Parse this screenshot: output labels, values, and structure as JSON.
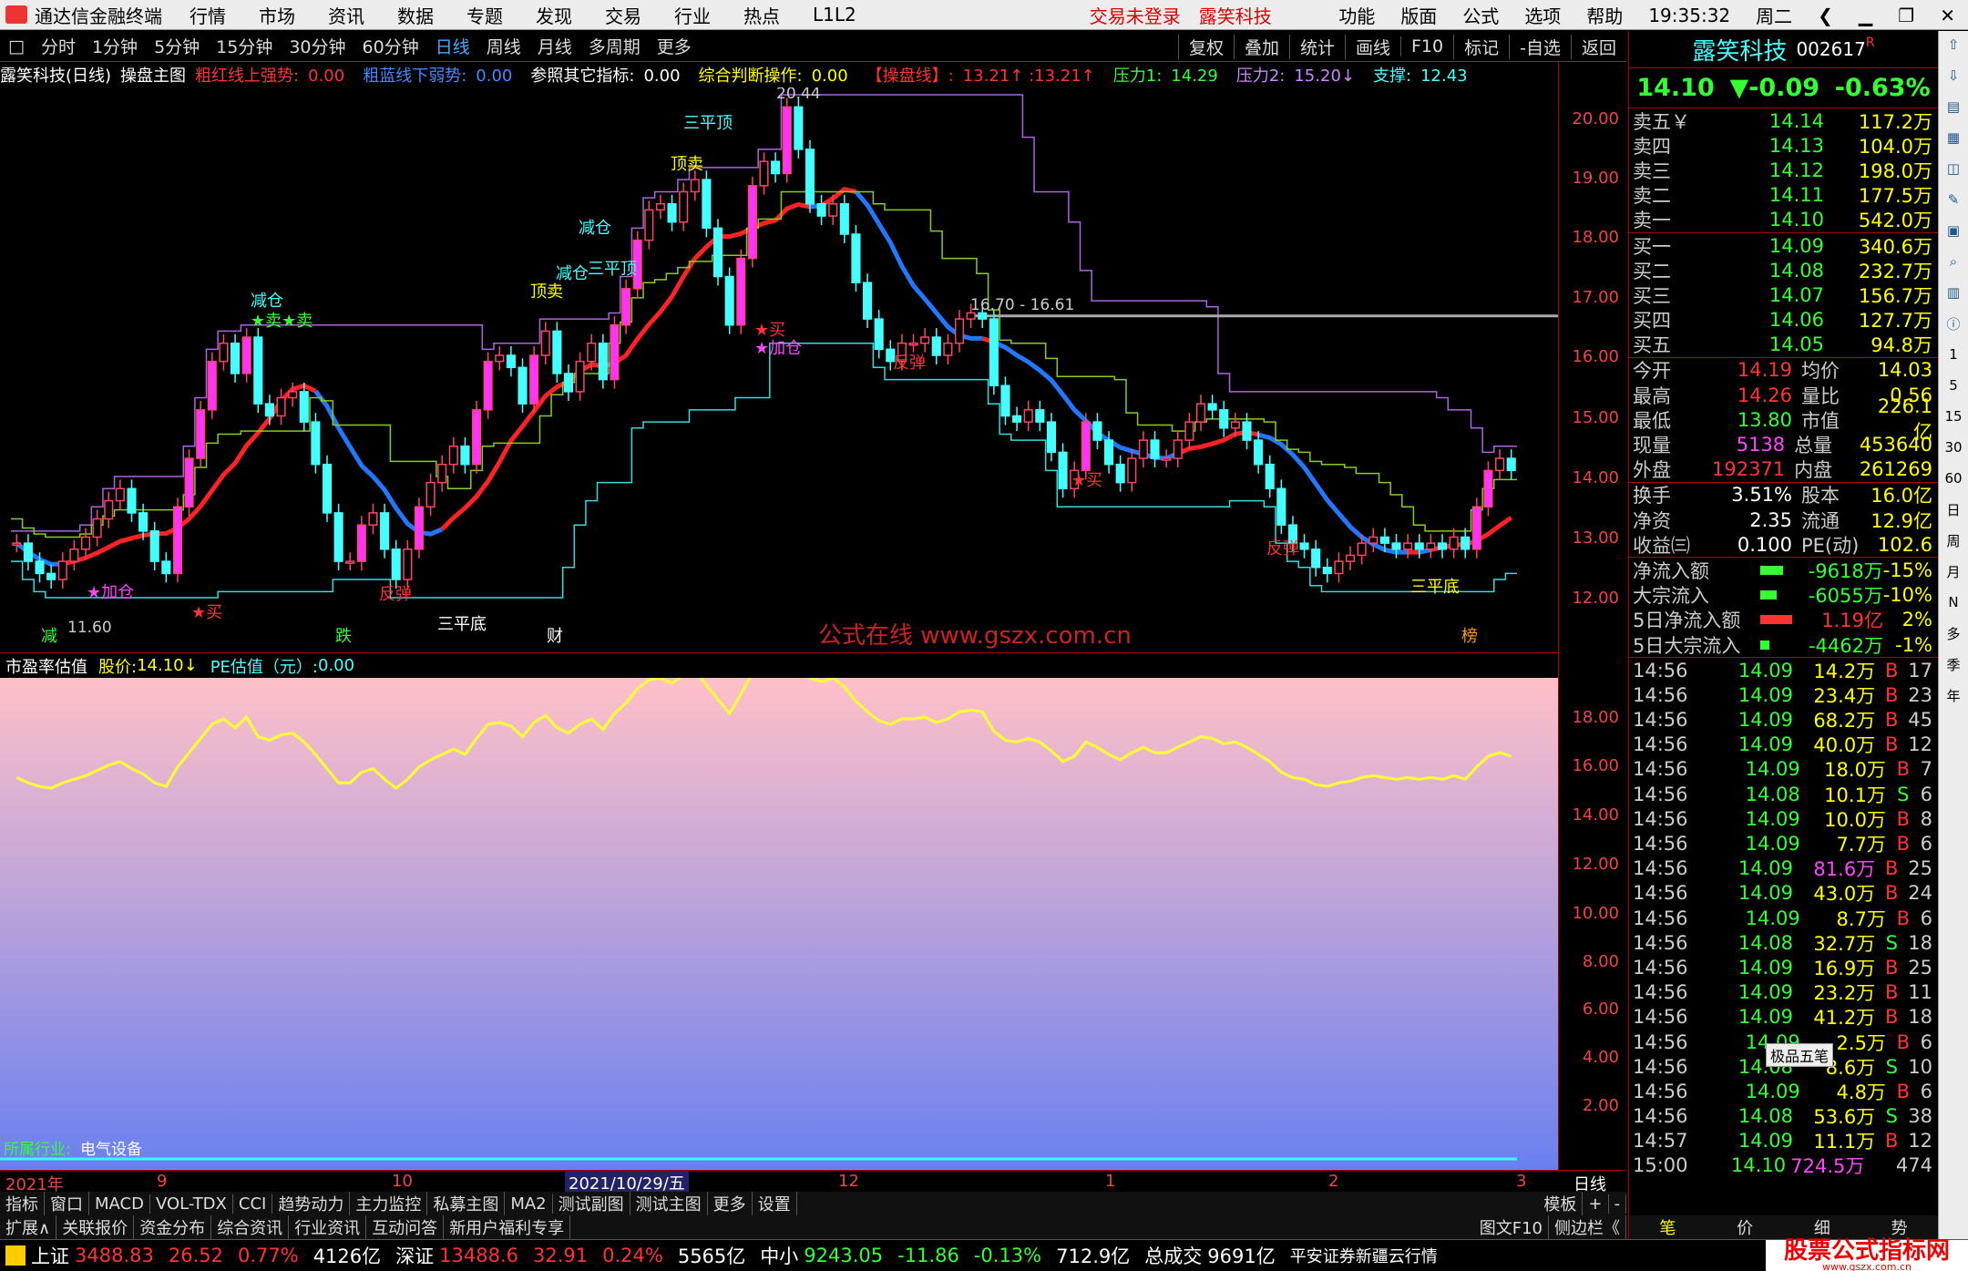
{
  "menubar": {
    "app_name": "通达信金融终端",
    "menus": [
      "行情",
      "市场",
      "资讯",
      "数据",
      "专题",
      "发现",
      "交易",
      "行业",
      "热点",
      "L1L2"
    ],
    "alert_login": "交易未登录",
    "alert_stock": "露笑科技",
    "right_menus": [
      "功能",
      "版面",
      "公式",
      "选项",
      "帮助"
    ],
    "time": "19:35:32",
    "weekday": "周二"
  },
  "toolbar": {
    "periods": [
      "分时",
      "1分钟",
      "5分钟",
      "15分钟",
      "30分钟",
      "60分钟",
      "日线",
      "周线",
      "月线",
      "多周期",
      "更多"
    ],
    "active_period": "日线",
    "right_buttons": [
      "复权",
      "叠加",
      "统计",
      "画线",
      "F10",
      "标记",
      "-自选",
      "返回"
    ]
  },
  "legend": {
    "stock": "露笑科技(日线)",
    "main_formula": "操盘主图",
    "items": [
      {
        "label": "粗红线上强势:",
        "value": "0.00",
        "color": "#ff3333"
      },
      {
        "label": "粗蓝线下弱势:",
        "value": "0.00",
        "color": "#4488ff"
      },
      {
        "label": "参照其它指标:",
        "value": "0.00",
        "color": "#ffffff"
      },
      {
        "label": "综合判断操作:",
        "value": "0.00",
        "color": "#ffff00"
      },
      {
        "label": "【操盘线】:",
        "value": "13.21↑ :13.21↑",
        "color": "#ff3333"
      },
      {
        "label": "压力1:",
        "value": "14.29",
        "color": "#33ff33"
      },
      {
        "label": "压力2:",
        "value": "15.20↓",
        "color": "#cc88ff"
      },
      {
        "label": "支撑:",
        "value": "12.43",
        "color": "#44ffff"
      }
    ]
  },
  "main_y_labels": [
    "20.00",
    "19.00",
    "18.00",
    "17.00",
    "16.00",
    "15.00",
    "14.00",
    "13.00",
    "12.00"
  ],
  "sub_y_labels": [
    "18.00",
    "16.00",
    "14.00",
    "12.00",
    "10.00",
    "8.00",
    "6.00",
    "4.00",
    "2.00"
  ],
  "annotations": {
    "peak": "20.44",
    "low": "11.60",
    "range_label": "16.70 - 16.61",
    "watermark": "公式在线  www.gszx.com.cn",
    "markers": [
      "三平顶",
      "顶卖",
      "减仓",
      "顶卖",
      "减仓",
      "三平顶",
      "减仓",
      "★卖★卖",
      "★加仓",
      "★买",
      "反弹",
      "三平底",
      "★买",
      "★加仓",
      "反弹",
      "★买",
      "反弹",
      "三平底",
      "减",
      "跌",
      "财",
      "榜"
    ]
  },
  "subchart": {
    "title": "市盈率估值",
    "price_label": "股价:",
    "price_value": "14.10↓",
    "pe_label": "PE估值（元）:",
    "pe_value": "0.00",
    "industry_label": "所属行业:",
    "industry": "电气设备"
  },
  "xaxis": {
    "labels": [
      "2021年",
      "9",
      "10",
      "2021/10/29/五",
      "12",
      "1",
      "2",
      "3"
    ],
    "right_label": "日线"
  },
  "bottom_tabs": [
    "指标",
    "窗口",
    "MACD",
    "VOL-TDX",
    "CCI",
    "趋势动力",
    "主力监控",
    "私募主图",
    "MA2",
    "测试副图",
    "测试主图",
    "更多",
    "设置"
  ],
  "bottom_tabs_right": [
    "模板",
    "+",
    "-"
  ],
  "bottom_tabs2": [
    "扩展∧",
    "关联报价",
    "资金分布",
    "综合资讯",
    "行业资讯",
    "互动问答",
    "新用户福利专享"
  ],
  "bottom_tabs2_right": [
    "图文F10",
    "侧边栏《"
  ],
  "quote": {
    "name": "露笑科技",
    "code": "002617",
    "flag": "R",
    "price": "14.10",
    "change": "▼-0.09",
    "pct": "-0.63%",
    "asks": [
      {
        "label": "卖五￥",
        "price": "14.14",
        "vol": "117.2万"
      },
      {
        "label": "卖四",
        "price": "14.13",
        "vol": "104.0万"
      },
      {
        "label": "卖三",
        "price": "14.12",
        "vol": "198.0万"
      },
      {
        "label": "卖二",
        "price": "14.11",
        "vol": "177.5万"
      },
      {
        "label": "卖一",
        "price": "14.10",
        "vol": "542.0万"
      }
    ],
    "bids": [
      {
        "label": "买一",
        "price": "14.09",
        "vol": "340.6万"
      },
      {
        "label": "买二",
        "price": "14.08",
        "vol": "232.7万"
      },
      {
        "label": "买三",
        "price": "14.07",
        "vol": "156.7万"
      },
      {
        "label": "买四",
        "price": "14.06",
        "vol": "127.7万"
      },
      {
        "label": "买五",
        "price": "14.05",
        "vol": "94.8万"
      }
    ],
    "stats": [
      [
        "今开",
        "14.19",
        "均价",
        "14.03"
      ],
      [
        "最高",
        "14.26",
        "量比",
        "0.56"
      ],
      [
        "最低",
        "13.80",
        "市值",
        "226.1亿"
      ],
      [
        "现量",
        "5138",
        "总量",
        "453640"
      ],
      [
        "外盘",
        "192371",
        "内盘",
        "261269"
      ]
    ],
    "stats2": [
      [
        "换手",
        "3.51%",
        "股本",
        "16.0亿"
      ],
      [
        "净资",
        "2.35",
        "流通",
        "12.9亿"
      ],
      [
        "收益㈢",
        "0.100",
        "PE(动)",
        "102.6"
      ]
    ],
    "flows": [
      {
        "label": "净流入额",
        "value": "-9618万",
        "pct": "-15%",
        "bar": "#33ff33"
      },
      {
        "label": "大宗流入",
        "value": "-6055万",
        "pct": "-10%",
        "bar": "#33ff33"
      },
      {
        "label": "5日净流入额",
        "value": "1.19亿",
        "pct": "2%",
        "bar": "#ff3333"
      },
      {
        "label": "5日大宗流入",
        "value": "-4462万",
        "pct": "-1%",
        "bar": "#33ff33"
      }
    ],
    "ticks": [
      [
        "14:56",
        "14.09",
        "14.2万",
        "B",
        "17"
      ],
      [
        "14:56",
        "14.09",
        "23.4万",
        "B",
        "23"
      ],
      [
        "14:56",
        "14.09",
        "68.2万",
        "B",
        "45"
      ],
      [
        "14:56",
        "14.09",
        "40.0万",
        "B",
        "12"
      ],
      [
        "14:56",
        "14.09",
        "18.0万",
        "B",
        "7"
      ],
      [
        "14:56",
        "14.08",
        "10.1万",
        "S",
        "6"
      ],
      [
        "14:56",
        "14.09",
        "10.0万",
        "B",
        "8"
      ],
      [
        "14:56",
        "14.09",
        "7.7万",
        "B",
        "6"
      ],
      [
        "14:56",
        "14.09",
        "81.6万",
        "B",
        "25"
      ],
      [
        "14:56",
        "14.09",
        "43.0万",
        "B",
        "24"
      ],
      [
        "14:56",
        "14.09",
        "8.7万",
        "B",
        "6"
      ],
      [
        "14:56",
        "14.08",
        "32.7万",
        "S",
        "18"
      ],
      [
        "14:56",
        "14.09",
        "16.9万",
        "B",
        "25"
      ],
      [
        "14:56",
        "14.09",
        "23.2万",
        "B",
        "11"
      ],
      [
        "14:56",
        "14.09",
        "41.2万",
        "B",
        "18"
      ],
      [
        "14:56",
        "14.09",
        "2.5万",
        "B",
        "6"
      ],
      [
        "14:56",
        "14.08",
        "8.6万",
        "S",
        "10"
      ],
      [
        "14:56",
        "14.09",
        "4.8万",
        "B",
        "6"
      ],
      [
        "14:56",
        "14.08",
        "53.6万",
        "S",
        "38"
      ],
      [
        "14:57",
        "14.09",
        "11.1万",
        "B",
        "12"
      ],
      [
        "15:00",
        "14.10",
        "724.5万",
        "",
        "474"
      ]
    ],
    "popup": "极品五笔",
    "bottom_tabs": [
      "笔",
      "价",
      "细",
      "势"
    ]
  },
  "sidebar_icons": [
    "up-icon",
    "down-icon",
    "news-icon",
    "grid-icon",
    "chart-icon",
    "pen-icon",
    "f10-icon",
    "search-icon",
    "calc-icon",
    "info-icon"
  ],
  "sidebar_labels": [
    "1",
    "5",
    "15",
    "30",
    "60",
    "日",
    "周",
    "月",
    "N",
    "多",
    "季",
    "年"
  ],
  "statusbar": {
    "sh_label": "上证",
    "sh_val": "3488.83",
    "sh_chg": "26.52",
    "sh_pct": "0.77%",
    "sh_amt": "4126亿",
    "sz_label": "深证",
    "sz_val": "13488.6",
    "sz_chg": "32.91",
    "sz_pct": "0.24%",
    "sz_amt": "5565亿",
    "zx_label": "中小",
    "zx_val": "9243.05",
    "zx_chg": "-11.86",
    "zx_pct": "-0.13%",
    "zx_amt": "712.9亿",
    "total_label": "总成交",
    "total_val": "9691亿",
    "broker": "平安证券新疆云行情",
    "site": "股票公式指标网",
    "site_url": "www.gszx.com.cn"
  },
  "colors": {
    "up": "#ff33ff",
    "down": "#44ffff",
    "ma_red": "#ff2222",
    "ma_blue": "#2277ff",
    "pe_line": "#ffff33",
    "grid": "#a00000"
  }
}
